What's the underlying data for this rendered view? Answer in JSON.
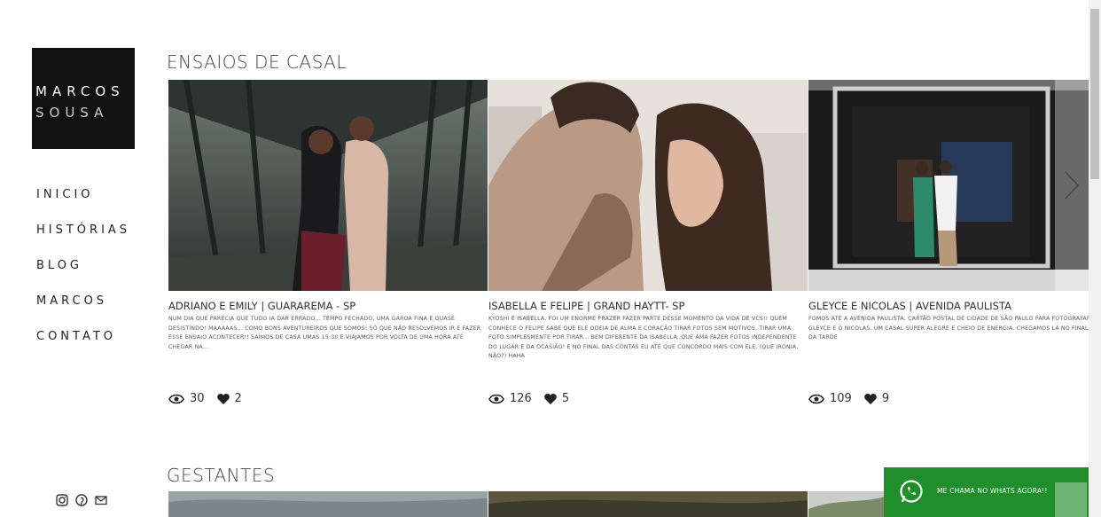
{
  "logo": {
    "line1": "MARCOS",
    "line2": "SOUSA"
  },
  "nav": [
    "INICIO",
    "HISTÓRIAS",
    "BLOG",
    "MARCOS",
    "CONTATO"
  ],
  "social_icons": [
    "instagram-icon",
    "pinterest-icon",
    "mail-icon"
  ],
  "sections": {
    "casal": {
      "title": "ENSAIOS DE CASAL",
      "cards": [
        {
          "title": "ADRIANO E EMILY | GUARAREMA - SP",
          "excerpt": "NUM DIA QUE PARECIA QUE TUDO IA DAR ERRADO... TEMPO FECHADO, UMA GAROA FINA E QUASE DESISTINDO! MAAAAAS... COMO BONS AVENTUREIROS QUE SOMOS! SÓ QUE NÃO RESOLVEMOS IR E FAZER ESSE ENSAIO ACONTECER!! SAÍMOS DE CASA UMAS 15:30 E VIAJAMOS POR VOLTA DE UMA HORA ATÉ CHEGAR NA...",
          "views": "30",
          "likes": "2"
        },
        {
          "title": "ISABELLA E FELIPE | GRAND HAYTT- SP",
          "excerpt": "KYOSHI E ISABELLA, FOI UM ENORME PRAZER FAZER PARTE DESSE MOMENTO DA VIDA DE VCS!! QUEM CONHECE O FELIPE SABE QUE ELE ODEIA DE ALMA E CORAÇÃO TIRAR FOTOS SEM MOTIVOS, TIRAR UMA FOTO SIMPLESMENTE POR TIRAR... BEM DIFERENTE DA ISABELLA, QUE AMA FAZER FOTOS INDEPENDENTE DO LUGAR E DA OCASIÃO! E NO FINAL DAS CONTAS EU ATÉ QUE CONCORDO MAIS COM ELE. (QUE IRONIA, NÃO?) HAHA",
          "views": "126",
          "likes": "5"
        },
        {
          "title": "GLEYCE E NICOLAS | AVENIDA PAULISTA",
          "excerpt": "FOMOS ATÉ A AVENIDA PAULISTA, CARTÃO POSTAL DE CIDADE DE SÃO PAULO PARA FOTOGRAFAR A GLEYCE E O NICOLAS. UM CASAL SUPER ALEGRE E CHEIO DE ENERGIA. CHEGAMOS LÁ NO FINALZINHO DA TARDE",
          "views": "109",
          "likes": "9"
        }
      ]
    },
    "gestantes": {
      "title": "GESTANTES"
    }
  },
  "whatsapp": {
    "label": "ME CHAMA NO WHATS AGORA!!",
    "color": "#1f8f2b"
  }
}
